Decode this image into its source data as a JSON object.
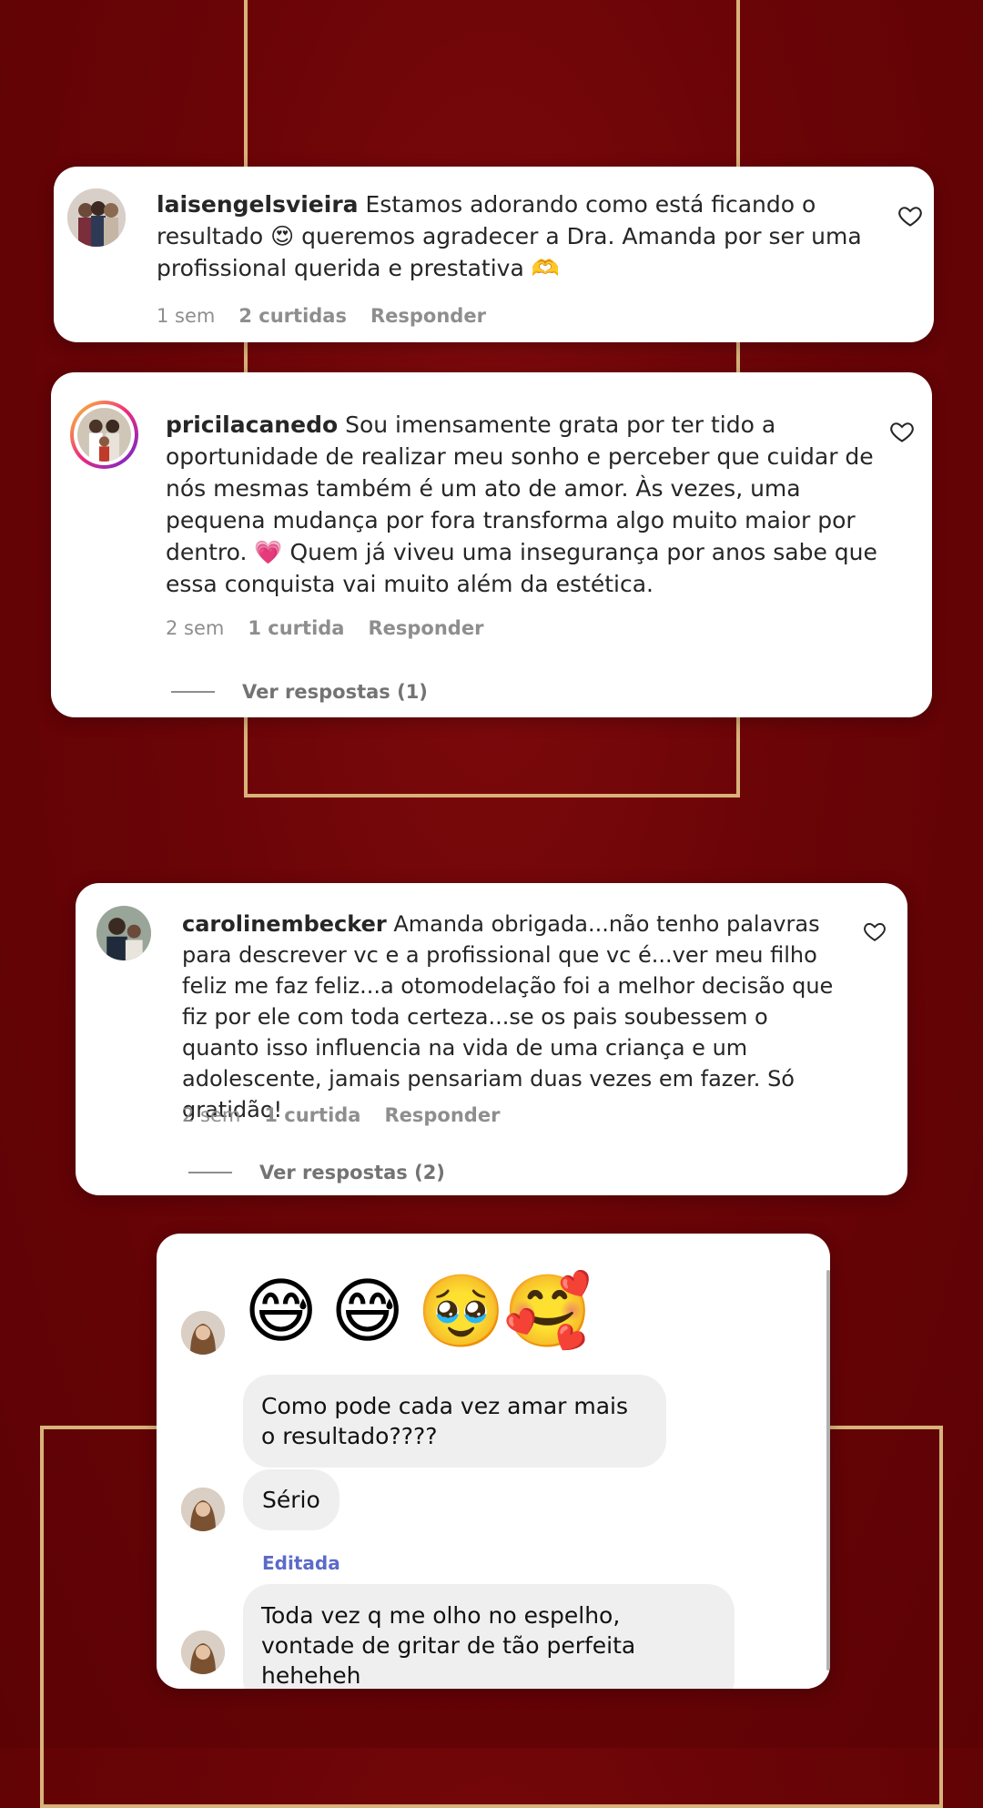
{
  "comments": [
    {
      "username": "laisengelsvieira",
      "text": "Estamos adorando como está ficando o resultado 😍 queremos agradecer a Dra. Amanda por ser uma profissional querida e prestativa 🫶",
      "time": "1 sem",
      "likes": "2 curtidas",
      "reply": "Responder"
    },
    {
      "username": "pricilacanedo",
      "text": "Sou imensamente grata por ter tido a oportunidade de realizar meu sonho e perceber que cuidar de nós mesmas também é um ato de amor. Às vezes, uma pequena mudança por fora transforma algo muito maior por dentro. 💗 Quem já viveu uma insegurança por anos sabe que essa conquista vai muito além da estética.",
      "time": "2 sem",
      "likes": "1 curtida",
      "reply": "Responder",
      "view_replies": "Ver respostas (1)"
    },
    {
      "username": "carolinembecker",
      "text": "Amanda obrigada...não tenho palavras para descrever vc e a profissional que vc é...ver meu filho feliz me faz feliz...a otomodelação foi a melhor decisão que fiz por ele com toda certeza...se os pais soubessem o quanto isso influencia na vida de uma criança e um adolescente, jamais pensariam duas vezes em fazer. Só gratidão!",
      "time": "2 sem",
      "likes": "1 curtida",
      "reply": "Responder",
      "view_replies": "Ver respostas (2)"
    }
  ],
  "chat": {
    "emojis": [
      "😅",
      "😅",
      "🥹",
      "🥰"
    ],
    "messages": [
      "Como pode cada vez amar mais o resultado????",
      "Sério",
      "Toda vez q me olho no espelho, vontade de gritar de tão perfeita heheheh"
    ],
    "edited_label": "Editada",
    "edited_color": "#5b6bc9"
  },
  "colors": {
    "background": "#6a0407",
    "gold": "#d9b27a"
  }
}
